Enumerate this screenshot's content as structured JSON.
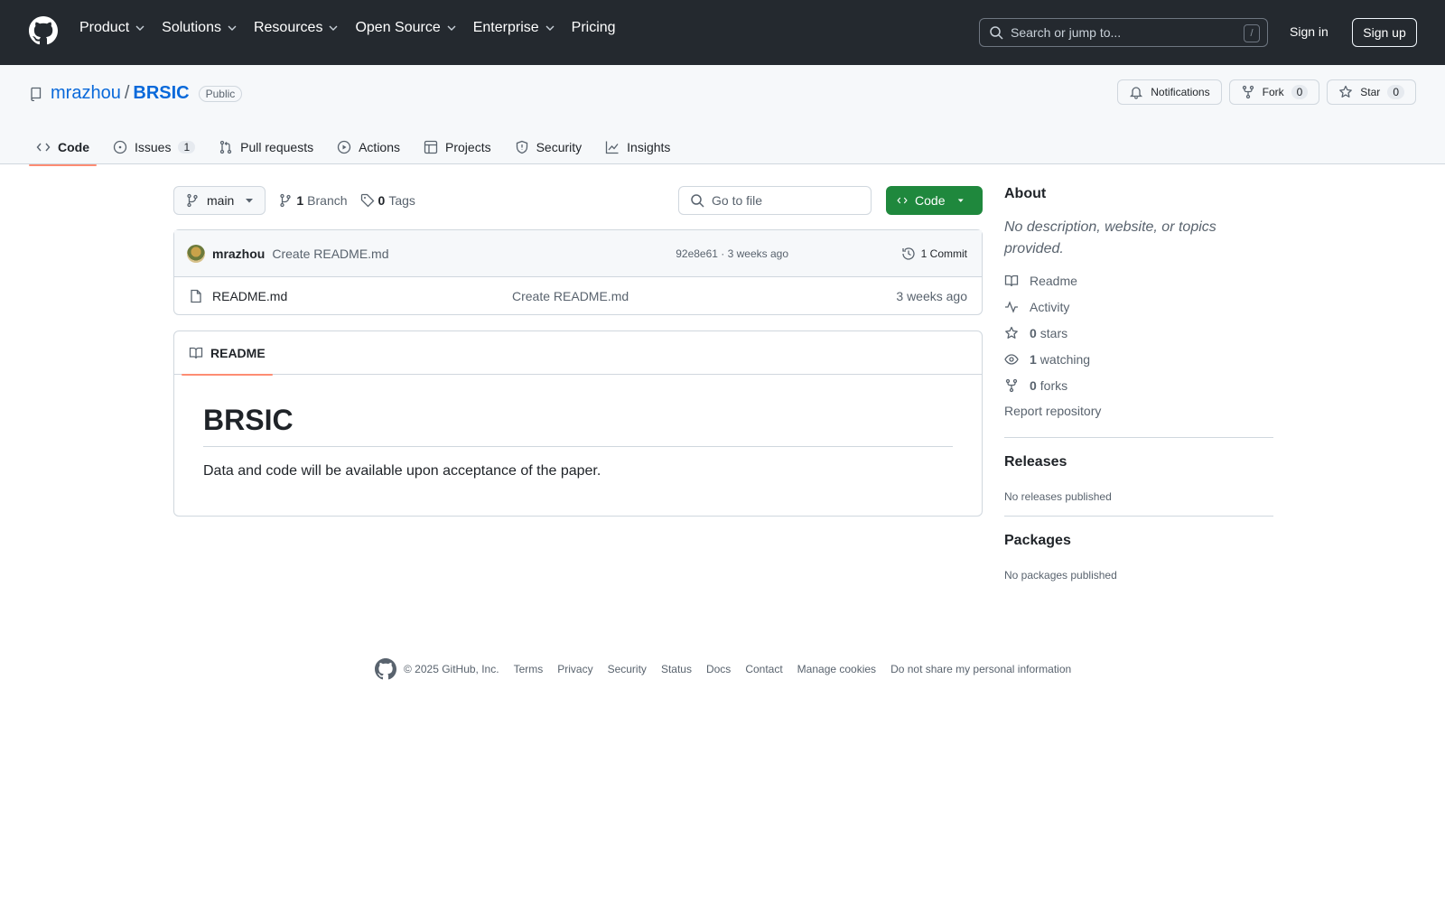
{
  "header": {
    "nav": [
      "Product",
      "Solutions",
      "Resources",
      "Open Source",
      "Enterprise",
      "Pricing"
    ],
    "search_placeholder": "Search or jump to...",
    "search_shortcut": "/",
    "sign_in": "Sign in",
    "sign_up": "Sign up"
  },
  "repo": {
    "owner": "mrazhou",
    "separator": "/",
    "name": "BRSIC",
    "visibility": "Public",
    "notifications_label": "Notifications",
    "fork_label": "Fork",
    "fork_count": "0",
    "star_label": "Star",
    "star_count": "0"
  },
  "tabs": {
    "code": "Code",
    "issues": "Issues",
    "issues_count": "1",
    "pull_requests": "Pull requests",
    "actions": "Actions",
    "projects": "Projects",
    "security": "Security",
    "insights": "Insights"
  },
  "toolbar": {
    "branch": "main",
    "branch_count": "1",
    "branch_label": "Branch",
    "tag_count": "0",
    "tag_label": "Tags",
    "goto_placeholder": "Go to file",
    "code_button": "Code"
  },
  "commit": {
    "author": "mrazhou",
    "message": "Create README.md",
    "meta": "92e8e61 · 3 weeks ago",
    "count": "1 Commit"
  },
  "files": [
    {
      "name": "README.md",
      "message": "Create README.md",
      "age": "3 weeks ago"
    }
  ],
  "readme": {
    "tab": "README",
    "title": "BRSIC",
    "body": "Data and code will be available upon acceptance of the paper."
  },
  "about": {
    "heading": "About",
    "description": "No description, website, or topics provided.",
    "readme": "Readme",
    "activity": "Activity",
    "stars_count": "0",
    "stars_label": "stars",
    "watching_count": "1",
    "watching_label": "watching",
    "forks_count": "0",
    "forks_label": "forks",
    "report": "Report repository"
  },
  "releases": {
    "heading": "Releases",
    "empty": "No releases published"
  },
  "packages": {
    "heading": "Packages",
    "empty": "No packages published"
  },
  "footer": {
    "copyright": "© 2025 GitHub, Inc.",
    "links": [
      "Terms",
      "Privacy",
      "Security",
      "Status",
      "Docs",
      "Contact",
      "Manage cookies",
      "Do not share my personal information"
    ]
  },
  "colors": {
    "header_bg": "#24292f",
    "link": "#0969da",
    "primary_button": "#1f883d",
    "tab_underline": "#fd8c73"
  }
}
